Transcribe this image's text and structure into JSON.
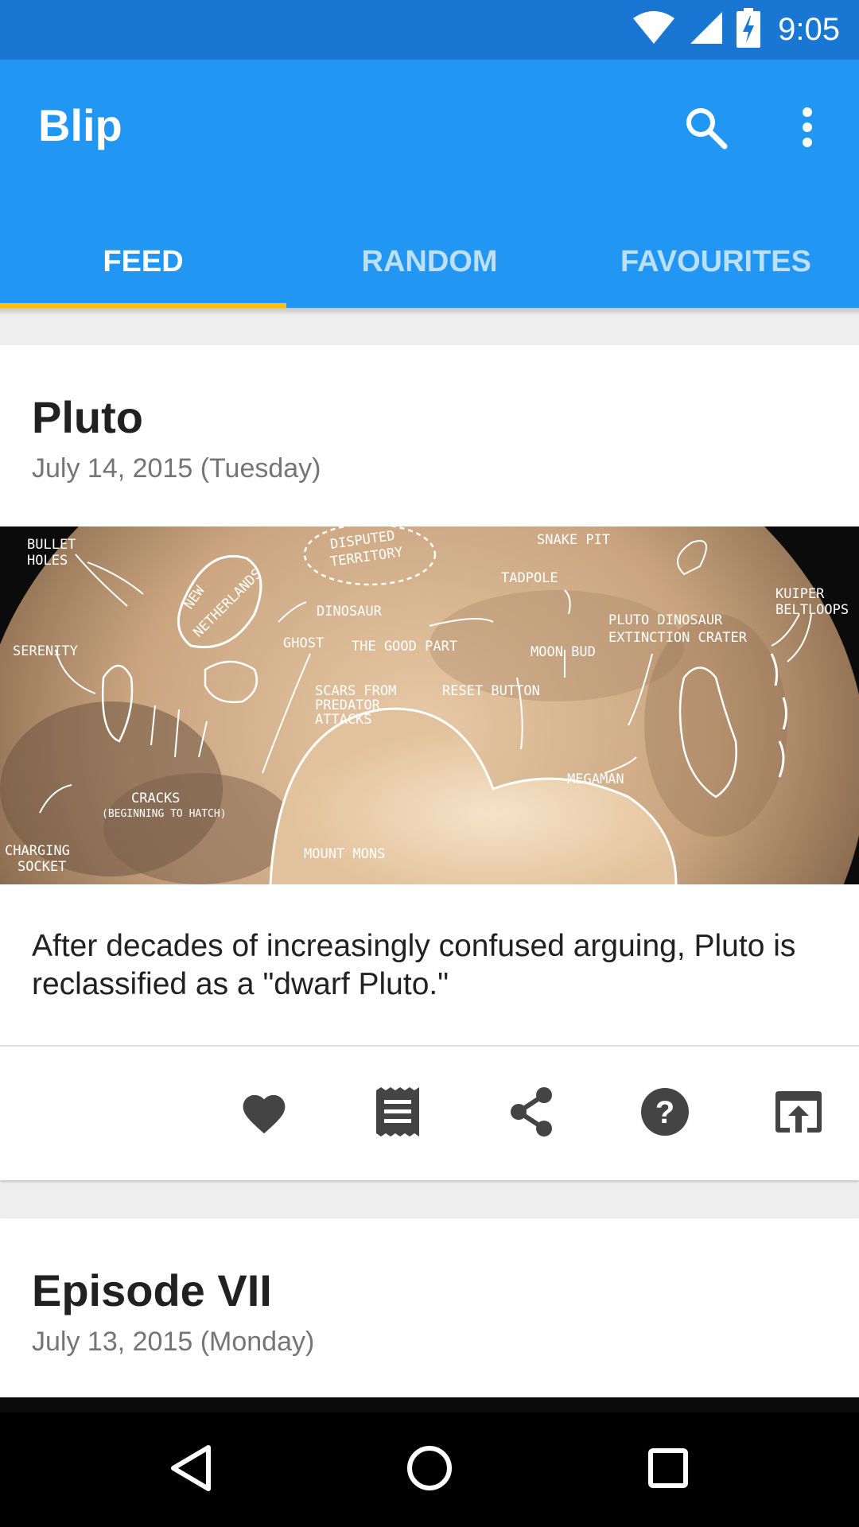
{
  "status_bar": {
    "time": "9:05",
    "icons": [
      "wifi-icon",
      "cell-signal-icon",
      "battery-charging-icon"
    ]
  },
  "app_bar": {
    "title": "Blip",
    "actions": [
      "search-icon",
      "overflow-menu-icon"
    ]
  },
  "tabs": [
    {
      "label": "FEED",
      "active": true
    },
    {
      "label": "RANDOM",
      "active": false
    },
    {
      "label": "FAVOURITES",
      "active": false
    }
  ],
  "accent_color": "#ffc107",
  "primary_color": "#2196f3",
  "primary_dark_color": "#1976d2",
  "comics": [
    {
      "title": "Pluto",
      "date": "July 14, 2015 (Tuesday)",
      "caption": "After decades of increasingly confused arguing, Pluto is reclassified as a \"dwarf Pluto.\"",
      "image_labels": {
        "bullet_holes_1": "BULLET",
        "bullet_holes_2": "HOLES",
        "disputed_1": "DISPUTED",
        "disputed_2": "TERRITORY",
        "snake_pit": "SNAKE PIT",
        "tadpole": "TADPOLE",
        "new_1": "NEW",
        "new_2": "NETHERLANDS",
        "dinosaur": "DINOSAUR",
        "ghost": "GHOST",
        "good_part": "THE GOOD PART",
        "moon_bud": "MOON BUD",
        "pluto_dino_1": "PLUTO DINOSAUR",
        "pluto_dino_2": "EXTINCTION CRATER",
        "kuiper_1": "KUIPER",
        "kuiper_2": "BELTLOOPS",
        "serenity": "SERENITY",
        "scars_1": "SCARS FROM",
        "scars_2": "PREDATOR",
        "scars_3": "ATTACKS",
        "reset": "RESET BUTTON",
        "megaman": "MEGAMAN",
        "cracks_1": "CRACKS",
        "cracks_2": "(BEGINNING TO HATCH)",
        "charging_1": "CHARGING",
        "charging_2": "SOCKET",
        "mount_mons": "MOUNT MONS"
      },
      "actions": [
        "favorite-icon",
        "transcript-icon",
        "share-icon",
        "explain-icon",
        "open-in-browser-icon"
      ]
    },
    {
      "title": "Episode VII",
      "date": "July 13, 2015 (Monday)"
    }
  ],
  "nav_bar": [
    "back-icon",
    "home-icon",
    "recents-icon"
  ]
}
